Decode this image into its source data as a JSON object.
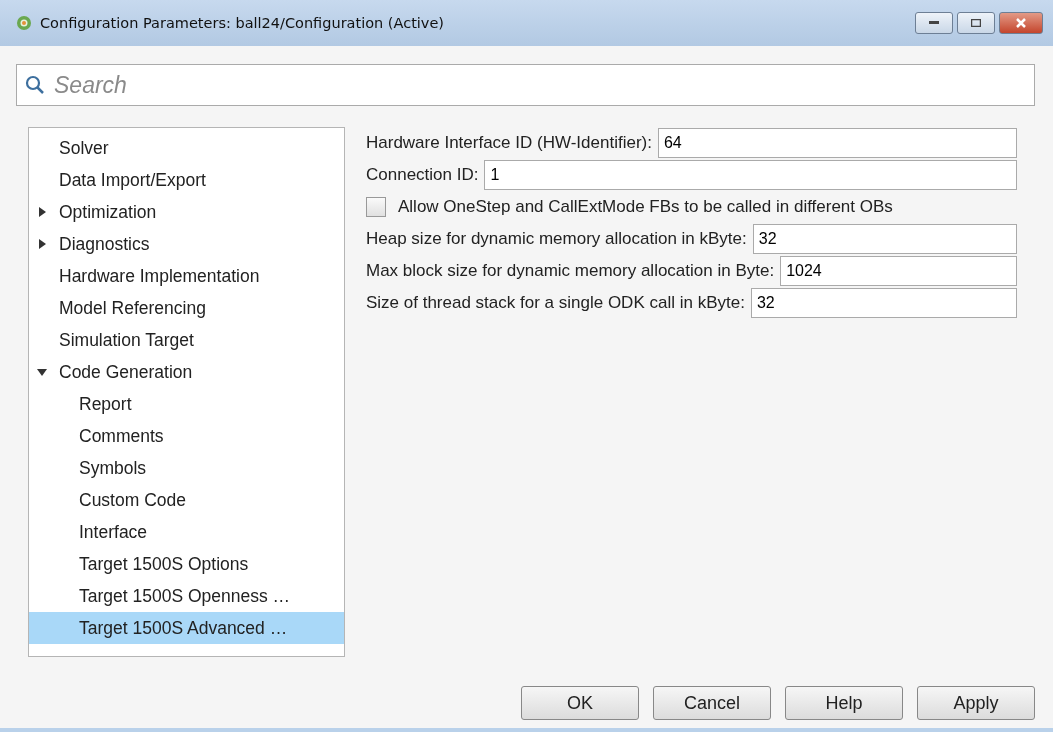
{
  "window": {
    "title": "Configuration Parameters: ball24/Configuration (Active)"
  },
  "search": {
    "placeholder": "Search"
  },
  "tree": [
    {
      "label": "Solver",
      "selected": false
    },
    {
      "label": "Data Import/Export",
      "selected": false
    },
    {
      "label": "Optimization",
      "selected": false,
      "expanded": false
    },
    {
      "label": "Diagnostics",
      "selected": false,
      "expanded": false
    },
    {
      "label": "Hardware Implementation",
      "selected": false
    },
    {
      "label": "Model Referencing",
      "selected": false
    },
    {
      "label": "Simulation Target",
      "selected": false
    },
    {
      "label": "Code Generation",
      "selected": false,
      "expanded": true,
      "children": [
        {
          "label": "Report",
          "selected": false
        },
        {
          "label": "Comments",
          "selected": false
        },
        {
          "label": "Symbols",
          "selected": false
        },
        {
          "label": "Custom Code",
          "selected": false
        },
        {
          "label": "Interface",
          "selected": false
        },
        {
          "label": "Target 1500S Options",
          "selected": false
        },
        {
          "label": "Target 1500S Openness …",
          "selected": false
        },
        {
          "label": "Target 1500S Advanced …",
          "selected": true
        }
      ]
    }
  ],
  "settings": [
    {
      "kind": "text",
      "label": "Hardware Interface ID (HW-Identifier):",
      "value": "64"
    },
    {
      "kind": "text",
      "label": "Connection ID:",
      "value": "1"
    },
    {
      "kind": "checkbox",
      "label": "Allow OneStep and CallExtMode FBs to be called in different OBs",
      "checked": false
    },
    {
      "kind": "text",
      "label": "Heap size for dynamic memory allocation in kByte:",
      "value": "32"
    },
    {
      "kind": "text",
      "label": "Max block size for dynamic memory allocation in Byte:",
      "value": "1024"
    },
    {
      "kind": "text",
      "label": "Size of thread stack for a single ODK call in kByte:",
      "value": "32"
    }
  ],
  "buttons": [
    "OK",
    "Cancel",
    "Help",
    "Apply"
  ]
}
